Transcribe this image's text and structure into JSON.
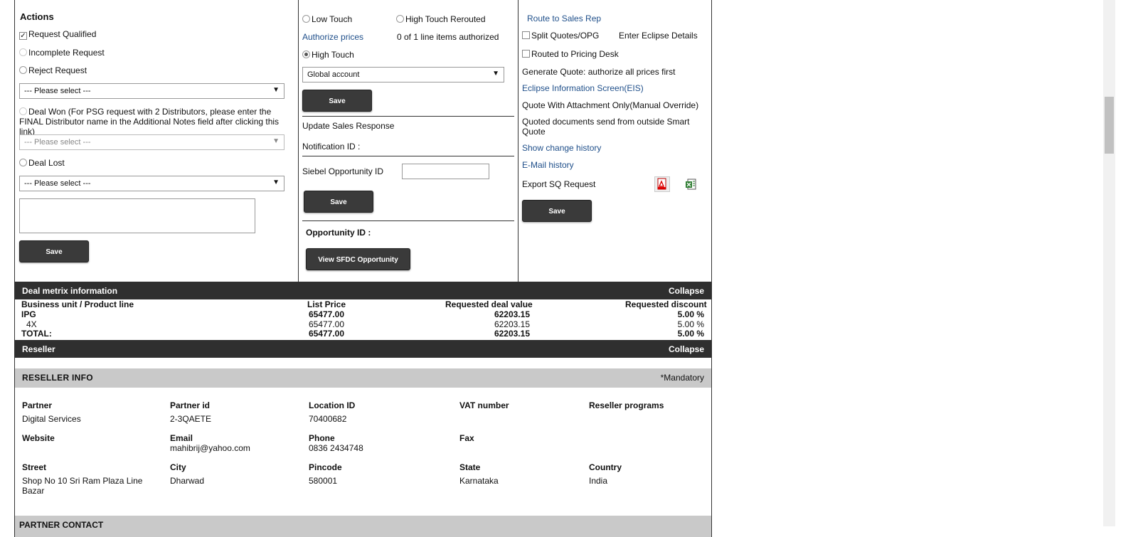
{
  "actions": {
    "title": "Actions",
    "request_qualified": "Request Qualified",
    "incomplete_request": "Incomplete Request",
    "reject_request": "Reject Request",
    "select1": "--- Please select ---",
    "deal_won": "Deal Won (For PSG request with 2 Distributors, please enter the FINAL Distributor name in the Additional Notes field after clicking this link)",
    "select2": "--- Please select ---",
    "deal_lost": "Deal Lost",
    "select3": "--- Please select ---",
    "save": "Save"
  },
  "middle": {
    "low_touch": "Low Touch",
    "high_touch_rerouted": "High Touch Rerouted",
    "authorize_prices": "Authorize prices",
    "authorized_count": "0 of 1 line items authorized",
    "high_touch": "High Touch",
    "account_select": "Global account",
    "save1": "Save",
    "update_sales_response": "Update Sales Response",
    "notification_id": "Notification ID :",
    "siebel_opportunity_id": "Siebel Opportunity ID",
    "save2": "Save",
    "opportunity_id": "Opportunity ID :",
    "view_sfdc": "View SFDC Opportunity"
  },
  "right": {
    "route_to_sales_rep": "Route to Sales Rep",
    "split_quotes": "Split Quotes/OPG",
    "enter_eclipse": "Enter Eclipse Details",
    "routed_pricing_desk": "Routed to Pricing Desk",
    "generate_quote": "Generate Quote: authorize all prices first",
    "eclipse_info": "Eclipse Information Screen(EIS)",
    "quote_attachment": "Quote With Attachment Only(Manual Override)",
    "quoted_docs": "Quoted documents send from outside Smart Quote",
    "show_change_history": "Show change history",
    "email_history": "E-Mail history",
    "export_sq": "Export SQ Request",
    "save": "Save"
  },
  "deal_metrix": {
    "title": "Deal metrix information",
    "collapse": "Collapse",
    "headers": [
      "Business unit / Product line",
      "List Price",
      "Requested deal value",
      "Requested discount"
    ],
    "rows": [
      [
        "IPG",
        "65477.00",
        "62203.15",
        "5.00 %"
      ],
      [
        "4X",
        "65477.00",
        "62203.15",
        "5.00 %"
      ],
      [
        "TOTAL:",
        "65477.00",
        "62203.15",
        "5.00 %"
      ]
    ]
  },
  "reseller": {
    "title": "Reseller",
    "collapse": "Collapse",
    "info_title": "RESELLER INFO",
    "mandatory": "*Mandatory",
    "partner_label": "Partner",
    "partner": "Digital Services",
    "partner_id_label": "Partner id",
    "partner_id": "2-3QAETE",
    "location_id_label": "Location ID",
    "location_id": "70400682",
    "vat_label": "VAT number",
    "programs_label": "Reseller programs",
    "website_label": "Website",
    "email_label": "Email",
    "email": "mahibrij@yahoo.com",
    "phone_label": "Phone",
    "phone": "0836 2434748",
    "fax_label": "Fax",
    "street_label": "Street",
    "street": "Shop No 10 Sri Ram Plaza Line Bazar",
    "city_label": "City",
    "city": "Dharwad",
    "pincode_label": "Pincode",
    "pincode": "580001",
    "state_label": "State",
    "state": "Karnataka",
    "country_label": "Country",
    "country": "India",
    "partner_contact": "PARTNER CONTACT"
  }
}
